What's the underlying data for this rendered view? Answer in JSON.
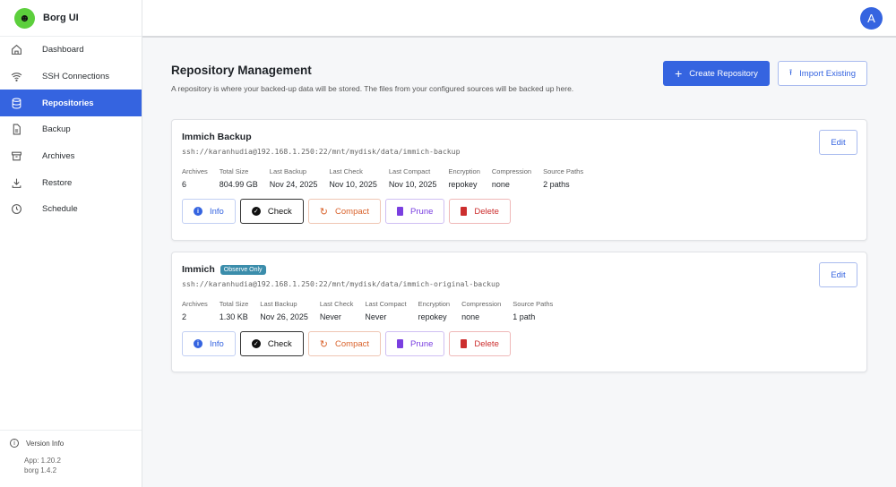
{
  "app": {
    "name": "Borg UI",
    "avatar_letter": "A"
  },
  "sidebar": {
    "items": [
      {
        "label": "Dashboard",
        "icon": "home-icon"
      },
      {
        "label": "SSH Connections",
        "icon": "wifi-icon"
      },
      {
        "label": "Repositories",
        "icon": "database-icon",
        "active": true
      },
      {
        "label": "Backup",
        "icon": "file-icon"
      },
      {
        "label": "Archives",
        "icon": "archive-icon"
      },
      {
        "label": "Restore",
        "icon": "download-icon"
      },
      {
        "label": "Schedule",
        "icon": "clock-icon"
      }
    ],
    "version": {
      "title": "Version Info",
      "app": "App: 1.20.2",
      "borg": "borg 1.4.2"
    }
  },
  "page": {
    "title": "Repository Management",
    "subtitle": "A repository is where your backed-up data will be stored. The files from your configured sources will be backed up here.",
    "create_label": "Create Repository",
    "import_label": "Import Existing"
  },
  "labels": {
    "archives": "Archives",
    "total_size": "Total Size",
    "last_backup": "Last Backup",
    "last_check": "Last Check",
    "last_compact": "Last Compact",
    "encryption": "Encryption",
    "compression": "Compression",
    "source_paths": "Source Paths",
    "edit": "Edit",
    "info": "Info",
    "check": "Check",
    "compact": "Compact",
    "prune": "Prune",
    "delete": "Delete"
  },
  "repos": [
    {
      "name": "Immich Backup",
      "badge": null,
      "path": "ssh://karanhudia@192.168.1.250:22/mnt/mydisk/data/immich-backup",
      "archives": "6",
      "total_size": "804.99 GB",
      "last_backup": "Nov 24, 2025",
      "last_check": "Nov 10, 2025",
      "last_compact": "Nov 10, 2025",
      "encryption": "repokey",
      "compression": "none",
      "source_paths": "2 paths"
    },
    {
      "name": "Immich",
      "badge": "Observe Only",
      "path": "ssh://karanhudia@192.168.1.250:22/mnt/mydisk/data/immich-original-backup",
      "archives": "2",
      "total_size": "1.30 KB",
      "last_backup": "Nov 26, 2025",
      "last_check": "Never",
      "last_compact": "Never",
      "encryption": "repokey",
      "compression": "none",
      "source_paths": "1 path"
    }
  ],
  "colors": {
    "accent": "#3564e0",
    "logo": "#5ccf3c",
    "badge": "#3b8dab"
  }
}
